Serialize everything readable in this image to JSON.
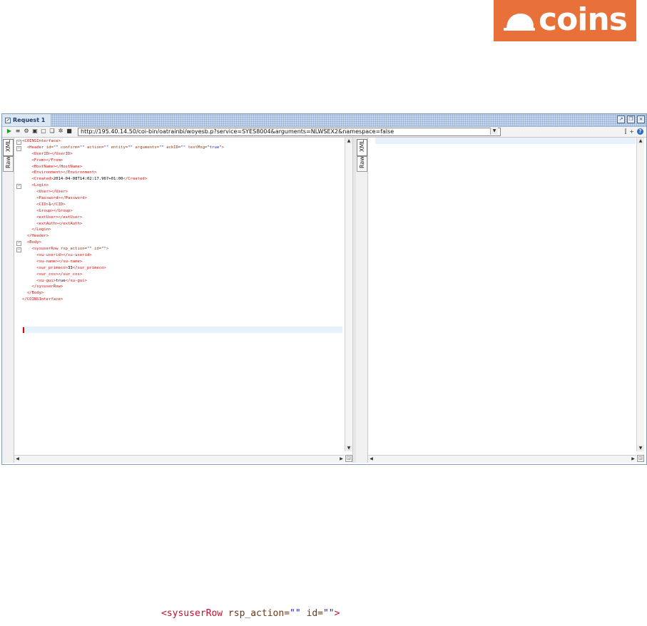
{
  "brand": {
    "logo_text": "coins",
    "color": "#e8713a"
  },
  "window": {
    "title": "Request 1",
    "url": "http://195.40.14.50/coi-bin/oatrainbi/woyesb.p?service=SYES8004&arguments=NLWSEX2&namespace=false"
  },
  "left_pane": {
    "tabs": [
      "XML",
      "Raw"
    ],
    "lines": [
      {
        "fold": "⊟",
        "indent": 0,
        "parts": [
          [
            "t",
            "<COINSInterface>"
          ]
        ]
      },
      {
        "fold": "⊟",
        "indent": 1,
        "parts": [
          [
            "t",
            "<Header "
          ],
          [
            "a",
            "id="
          ],
          [
            "v",
            "\"\" "
          ],
          [
            "a",
            "confirm="
          ],
          [
            "v",
            "\"\" "
          ],
          [
            "a",
            "action="
          ],
          [
            "v",
            "\"\" "
          ],
          [
            "a",
            "entity="
          ],
          [
            "v",
            "\"\" "
          ],
          [
            "a",
            "arguments="
          ],
          [
            "v",
            "\"\" "
          ],
          [
            "a",
            "ackID="
          ],
          [
            "v",
            "\"\" "
          ],
          [
            "a",
            "testMsg="
          ],
          [
            "v",
            "\"true\""
          ],
          [
            "t",
            ">"
          ]
        ]
      },
      {
        "fold": "",
        "indent": 2,
        "parts": [
          [
            "t",
            "<UserID>"
          ],
          [
            "t",
            "</UserID>"
          ]
        ]
      },
      {
        "fold": "",
        "indent": 2,
        "parts": [
          [
            "t",
            "<From>"
          ],
          [
            "t",
            "</From>"
          ]
        ]
      },
      {
        "fold": "",
        "indent": 2,
        "parts": [
          [
            "t",
            "<HostName>"
          ],
          [
            "t",
            "</HostName>"
          ]
        ]
      },
      {
        "fold": "",
        "indent": 2,
        "parts": [
          [
            "t",
            "<Environment>"
          ],
          [
            "t",
            "</Environment>"
          ]
        ]
      },
      {
        "fold": "",
        "indent": 2,
        "parts": [
          [
            "t",
            "<Created>"
          ],
          [
            "tx",
            "2014-04-08T14:02:17.967+01:00"
          ],
          [
            "t",
            "</Created>"
          ]
        ]
      },
      {
        "fold": "⊟",
        "indent": 2,
        "parts": [
          [
            "t",
            "<Login>"
          ]
        ]
      },
      {
        "fold": "",
        "indent": 3,
        "parts": [
          [
            "t",
            "<User>"
          ],
          [
            "t",
            "</User>"
          ]
        ]
      },
      {
        "fold": "",
        "indent": 3,
        "parts": [
          [
            "t",
            "<Password>"
          ],
          [
            "t",
            "</Password>"
          ]
        ]
      },
      {
        "fold": "",
        "indent": 3,
        "parts": [
          [
            "t",
            "<CID>"
          ],
          [
            "tx",
            "1"
          ],
          [
            "t",
            "</CID>"
          ]
        ]
      },
      {
        "fold": "",
        "indent": 3,
        "parts": [
          [
            "t",
            "<Group>"
          ],
          [
            "t",
            "</Group>"
          ]
        ]
      },
      {
        "fold": "",
        "indent": 3,
        "parts": [
          [
            "t",
            "<extUser>"
          ],
          [
            "t",
            "</extUser>"
          ]
        ]
      },
      {
        "fold": "",
        "indent": 3,
        "parts": [
          [
            "t",
            "<extAuth>"
          ],
          [
            "t",
            "</extAuth>"
          ]
        ]
      },
      {
        "fold": "",
        "indent": 2,
        "parts": [
          [
            "t",
            "</Login>"
          ]
        ]
      },
      {
        "fold": "",
        "indent": 1,
        "parts": [
          [
            "t",
            "</Header>"
          ]
        ]
      },
      {
        "fold": "⊟",
        "indent": 1,
        "parts": [
          [
            "t",
            "<Body>"
          ]
        ]
      },
      {
        "fold": "⊟",
        "indent": 2,
        "parts": [
          [
            "t",
            "<sysuserRow "
          ],
          [
            "a",
            "rsp_action="
          ],
          [
            "v",
            "\"\" "
          ],
          [
            "a",
            "id="
          ],
          [
            "v",
            "\"\""
          ],
          [
            "t",
            ">"
          ]
        ]
      },
      {
        "fold": "",
        "indent": 3,
        "parts": [
          [
            "t",
            "<su-userid>"
          ],
          [
            "t",
            "</su-userid>"
          ]
        ]
      },
      {
        "fold": "",
        "indent": 3,
        "parts": [
          [
            "t",
            "<su-name>"
          ],
          [
            "t",
            "</su-name>"
          ]
        ]
      },
      {
        "fold": "",
        "indent": 3,
        "parts": [
          [
            "t",
            "<sur_primeco>"
          ],
          [
            "tx",
            "33"
          ],
          [
            "t",
            "</sur_primeco>"
          ]
        ]
      },
      {
        "fold": "",
        "indent": 3,
        "parts": [
          [
            "t",
            "<sur_cos>"
          ],
          [
            "t",
            "</sur_cos>"
          ]
        ]
      },
      {
        "fold": "",
        "indent": 3,
        "parts": [
          [
            "t",
            "<su-gui>"
          ],
          [
            "tx",
            "true"
          ],
          [
            "t",
            "</su-gui>"
          ]
        ]
      },
      {
        "fold": "",
        "indent": 2,
        "parts": [
          [
            "t",
            "</sysuserRow>"
          ]
        ]
      },
      {
        "fold": "",
        "indent": 1,
        "parts": [
          [
            "t",
            "</Body>"
          ]
        ]
      },
      {
        "fold": "",
        "indent": 0,
        "parts": [
          [
            "t",
            "</COINSInterface>"
          ]
        ]
      }
    ]
  },
  "right_pane": {
    "tabs": [
      "XML",
      "Raw"
    ]
  },
  "snippet": {
    "parts": [
      [
        "t",
        "<sysuserRow "
      ],
      [
        "a",
        "rsp_action="
      ],
      [
        "v",
        "\"\" "
      ],
      [
        "a",
        "id="
      ],
      [
        "v",
        "\"\""
      ],
      [
        "t",
        ">"
      ]
    ]
  }
}
